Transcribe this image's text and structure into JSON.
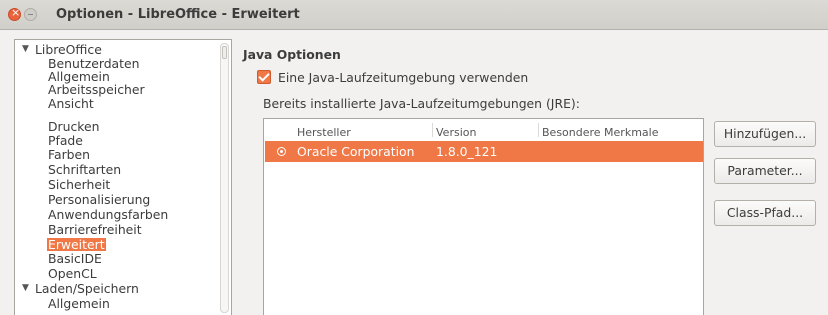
{
  "window": {
    "title": "Optionen - LibreOffice - Erweitert"
  },
  "tree": {
    "groups": [
      {
        "label": "LibreOffice",
        "expanded": true
      },
      {
        "label": "Laden/Speichern",
        "expanded": true
      }
    ],
    "items": [
      "Benutzerdaten",
      "Allgemein",
      "Arbeitsspeicher",
      "Ansicht",
      "Drucken",
      "Pfade",
      "Farben",
      "Schriftarten",
      "Sicherheit",
      "Personalisierung",
      "Anwendungsfarben",
      "Barrierefreiheit",
      "Erweitert",
      "BasicIDE",
      "OpenCL"
    ],
    "sub_items": [
      "Allgemein"
    ],
    "selected": "Erweitert"
  },
  "java": {
    "section_title": "Java Optionen",
    "use_jre_label": "Eine Java-Laufzeitumgebung verwenden",
    "use_jre_checked": true,
    "installed_label": "Bereits installierte Java-Laufzeitumgebungen (JRE):",
    "columns": [
      "Hersteller",
      "Version",
      "Besondere Merkmale"
    ],
    "rows": [
      {
        "vendor": "Oracle Corporation",
        "version": "1.8.0_121",
        "features": "",
        "selected": true
      }
    ],
    "buttons": {
      "add": "Hinzufügen...",
      "parameters": "Parameter...",
      "classpath": "Class-Pfad..."
    }
  },
  "colors": {
    "accent": "#f07746",
    "background": "#f2f1f0"
  }
}
